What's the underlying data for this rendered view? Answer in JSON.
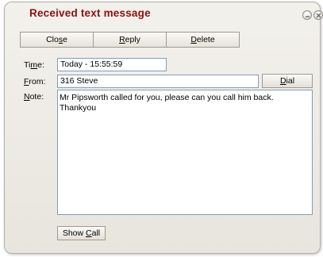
{
  "window": {
    "title": "Received text message"
  },
  "toolbar": {
    "close": {
      "pre": "Clo",
      "key": "s",
      "post": "e"
    },
    "reply": {
      "pre": "",
      "key": "R",
      "post": "eply"
    },
    "delete": {
      "pre": "",
      "key": "D",
      "post": "elete"
    }
  },
  "form": {
    "time": {
      "label_pre": "Ti",
      "label_key": "m",
      "label_post": "e:",
      "value": "Today - 15:55:59"
    },
    "from": {
      "label_pre": "",
      "label_key": "F",
      "label_post": "rom:",
      "value": "316  Steve"
    },
    "note": {
      "label_pre": "",
      "label_key": "N",
      "label_post": "ote:",
      "value": "Mr Pipsworth called for you, please can you call him back. Thankyou"
    }
  },
  "buttons": {
    "dial": {
      "pre": "",
      "key": "D",
      "post": "ial"
    },
    "show_call": {
      "pre": "Show ",
      "key": "C",
      "post": "all"
    }
  }
}
